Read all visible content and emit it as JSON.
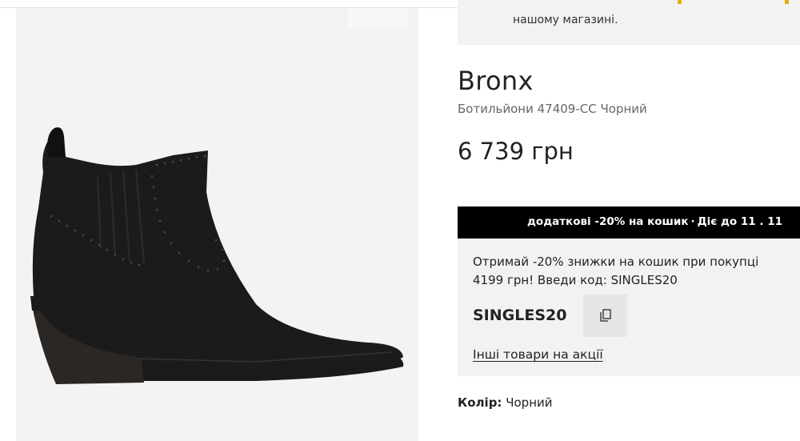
{
  "notice": {
    "text": "нашому магазині."
  },
  "product": {
    "brand": "Bronx",
    "subtitle": "Ботильйони 47409-CC Чорний",
    "price": "6 739 грн"
  },
  "promo_bar": {
    "text": "додаткові -20% на кошик",
    "separator": "·",
    "validity": "Діє до  11 . 11"
  },
  "promo": {
    "description_line1": "Отримай -20% знижки на кошик при покупці",
    "description_line2": "4199 грн! Введи код: SINGLES20",
    "code": "SINGLES20",
    "more_link": "Інші товари на акції"
  },
  "color": {
    "label": "Колір:",
    "value": "Чорний"
  },
  "icons": {
    "copy": "copy-icon"
  },
  "colors": {
    "promo_bar_bg": "#000000",
    "panel_bg": "#f2f2f2",
    "gallery_bg": "#f3f3f3",
    "accent_dots": "#e0b000"
  }
}
